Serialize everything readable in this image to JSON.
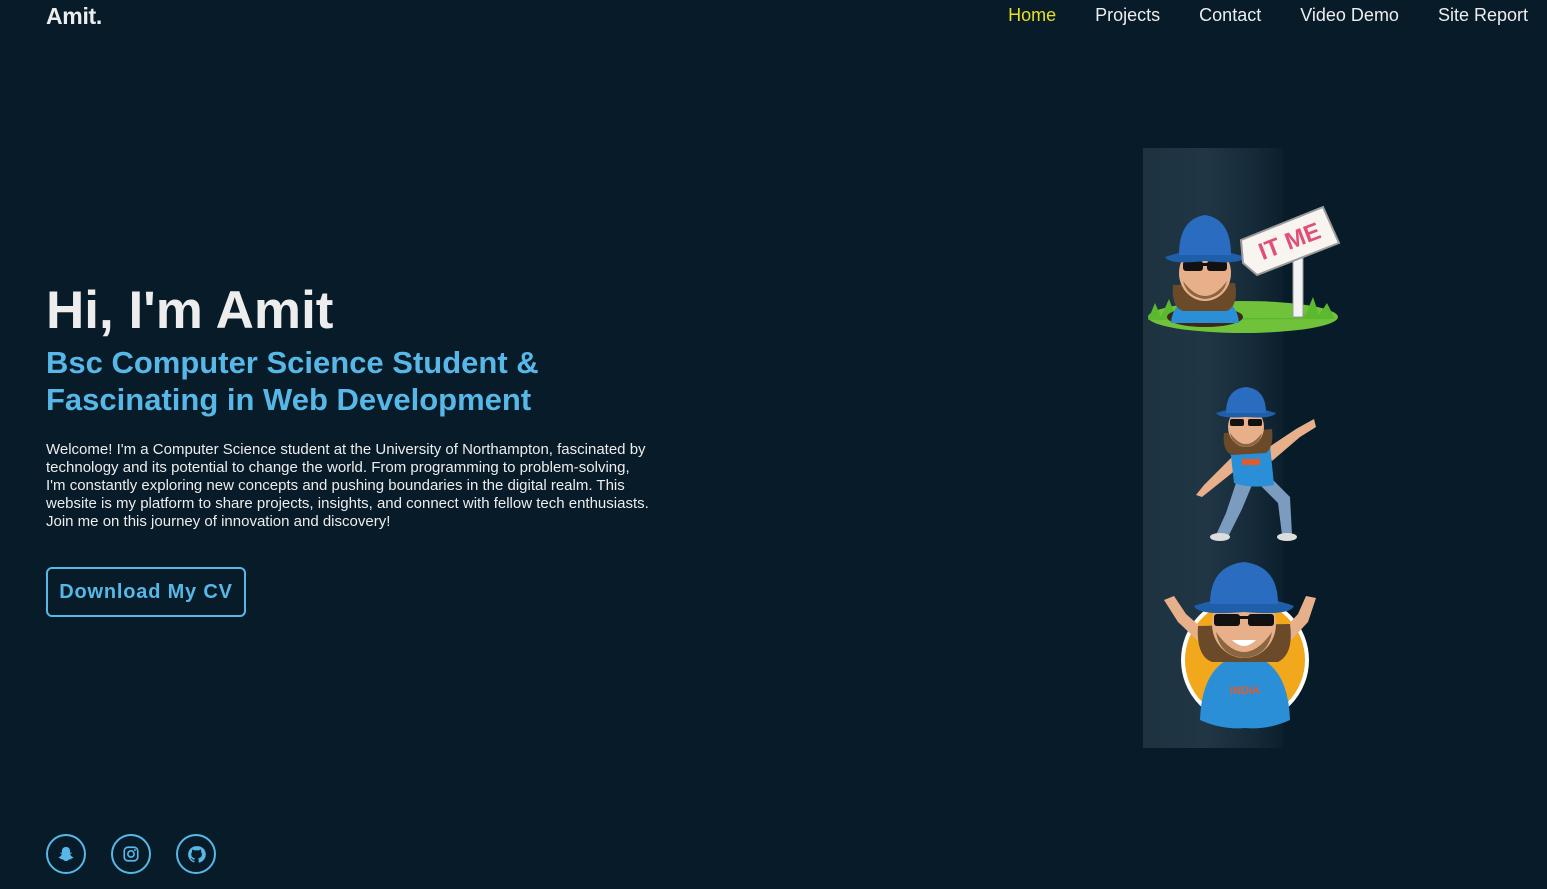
{
  "header": {
    "logo": "Amit.",
    "nav": [
      {
        "label": "Home",
        "active": true
      },
      {
        "label": "Projects",
        "active": false
      },
      {
        "label": "Contact",
        "active": false
      },
      {
        "label": "Video Demo",
        "active": false
      },
      {
        "label": "Site Report",
        "active": false
      }
    ]
  },
  "home": {
    "greeting": "Hi, I'm Amit",
    "subtitle_line1": "Bsc Computer Science Student &",
    "subtitle_line2": "Fascinating in Web Development",
    "intro": "Welcome! I'm a Computer Science student at the University of Northampton, fascinated by technology and its potential to change the world. From programming to problem-solving, I'm constantly exploring new concepts and pushing boundaries in the digital realm. This website is my platform to share projects, insights, and connect with fellow tech enthusiasts. Join me on this journey of innovation and discovery!",
    "cv_button": "Download My CV"
  },
  "illustration": {
    "sign_text": "IT ME",
    "jersey_text": "INDIA"
  },
  "social": [
    {
      "icon": "snapchat-icon"
    },
    {
      "icon": "instagram-icon"
    },
    {
      "icon": "github-icon"
    }
  ],
  "colors": {
    "background": "#081b29",
    "accent": "#57b8e8",
    "active_nav": "#e5e023",
    "text": "#ededed"
  }
}
